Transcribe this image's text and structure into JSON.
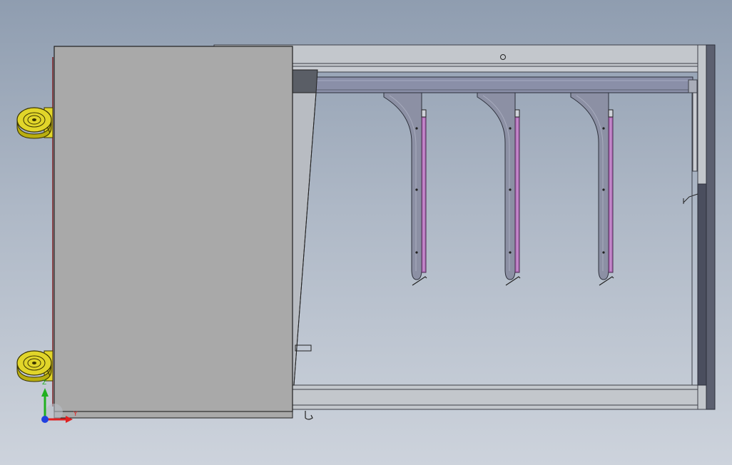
{
  "colors": {
    "background_top": "#8f9db0",
    "background_bottom": "#cdd3dc",
    "door_panel": "#a9a9a9",
    "frame_gray": "#c3c7cc",
    "frame_dark": "#5c6070",
    "rail_blue": "#8a8fa8",
    "bracket": "#8c90a4",
    "slot_purple": "#b070b8",
    "caster_yellow": "#e1d52a",
    "axis_x": "#e02020",
    "axis_y": "#20b020",
    "axis_z": "#2040e0"
  },
  "triad": {
    "x_label": "Y",
    "y_label": "Z"
  },
  "brackets": [
    {
      "name": "hanger-bracket-1"
    },
    {
      "name": "hanger-bracket-2"
    },
    {
      "name": "hanger-bracket-3"
    }
  ],
  "casters": [
    {
      "name": "caster-wheel-top"
    },
    {
      "name": "caster-wheel-bottom"
    }
  ]
}
